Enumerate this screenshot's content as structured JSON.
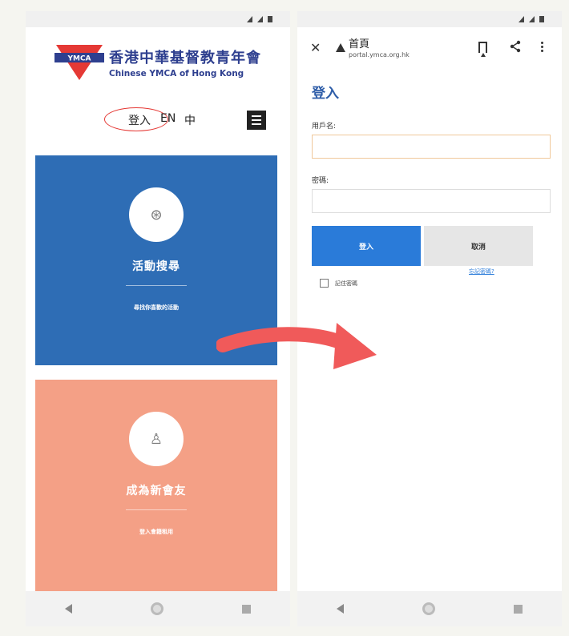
{
  "left_phone": {
    "logo": {
      "name_zh": "香港中華基督教青年會",
      "name_en": "Chinese YMCA of Hong Kong",
      "emblem_text": "YMCA"
    },
    "header": {
      "login_link": "登入",
      "lang_en": "EN",
      "lang_zh": "中"
    },
    "cards": [
      {
        "icon": "basketball-icon",
        "icon_glyph": "⊛",
        "title": "活動搜尋",
        "subtitle": "尋找你喜歡的活動",
        "color": "#2e6db5"
      },
      {
        "icon": "person-icon",
        "icon_glyph": "♙",
        "title": "成為新會友",
        "subtitle": "登入會籍租用",
        "color": "#f4a086"
      }
    ]
  },
  "right_phone": {
    "browser": {
      "page_title": "首頁",
      "url": "portal.ymca.org.hk"
    },
    "form": {
      "heading": "登入",
      "username_label": "用戶名:",
      "username_value": "",
      "password_label": "密碼:",
      "password_value": "",
      "login_button": "登入",
      "cancel_button": "取消",
      "forgot_link": "忘記密碼?",
      "remember_label": "記住密碼"
    }
  },
  "colors": {
    "brand_blue": "#2e3f8f",
    "login_button": "#2a7bd9",
    "highlight_circle": "#e53935",
    "arrow": "#f05a5a"
  }
}
